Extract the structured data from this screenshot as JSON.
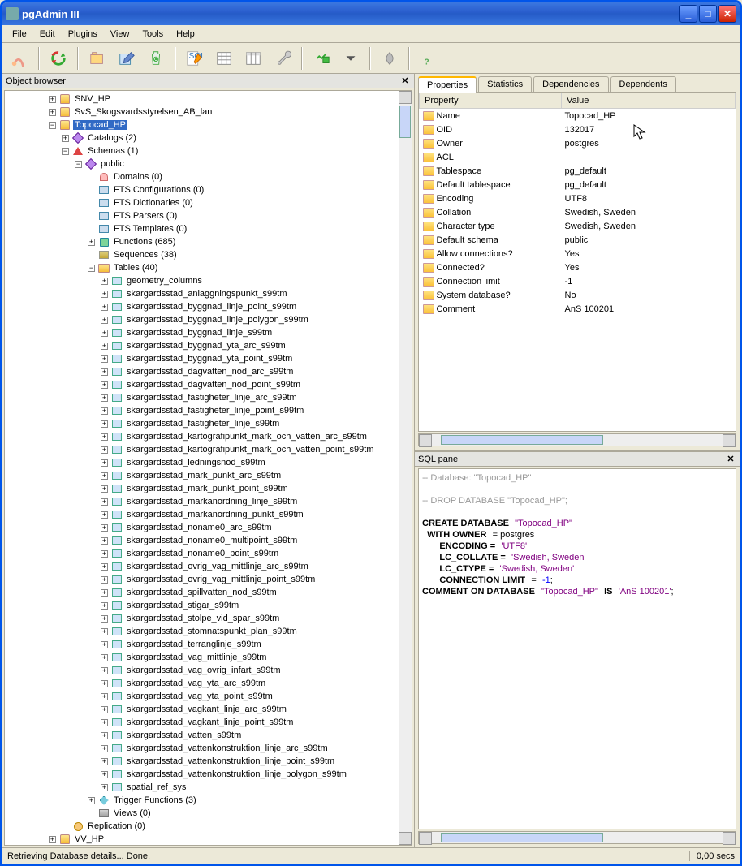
{
  "title": "pgAdmin III",
  "menus": [
    "File",
    "Edit",
    "Plugins",
    "View",
    "Tools",
    "Help"
  ],
  "object_browser_title": "Object browser",
  "sql_pane_title": "SQL pane",
  "status_left": "Retrieving Database details... Done.",
  "status_right": "0,00 secs",
  "tabs": [
    "Properties",
    "Statistics",
    "Dependencies",
    "Dependents"
  ],
  "prop_headers": [
    "Property",
    "Value"
  ],
  "properties": [
    {
      "name": "Name",
      "value": "Topocad_HP"
    },
    {
      "name": "OID",
      "value": "132017"
    },
    {
      "name": "Owner",
      "value": "postgres"
    },
    {
      "name": "ACL",
      "value": ""
    },
    {
      "name": "Tablespace",
      "value": "pg_default"
    },
    {
      "name": "Default tablespace",
      "value": "pg_default"
    },
    {
      "name": "Encoding",
      "value": "UTF8"
    },
    {
      "name": "Collation",
      "value": "Swedish, Sweden"
    },
    {
      "name": "Character type",
      "value": "Swedish, Sweden"
    },
    {
      "name": "Default schema",
      "value": "public"
    },
    {
      "name": "Allow connections?",
      "value": "Yes"
    },
    {
      "name": "Connected?",
      "value": "Yes"
    },
    {
      "name": "Connection limit",
      "value": "-1"
    },
    {
      "name": "System database?",
      "value": "No"
    },
    {
      "name": "Comment",
      "value": "AnS 100201"
    }
  ],
  "sql": {
    "c1": "-- Database: \"Topocad_HP\"",
    "c2": "-- DROP DATABASE \"Topocad_HP\";",
    "l1a": "CREATE DATABASE",
    "l1b": "\"Topocad_HP\"",
    "l2a": "  WITH OWNER",
    "l2b": "= postgres",
    "l3a": "       ENCODING =",
    "l3b": "'UTF8'",
    "l4a": "       LC_COLLATE =",
    "l4b": "'Swedish, Sweden'",
    "l5a": "       LC_CTYPE =",
    "l5b": "'Swedish, Sweden'",
    "l6a": "       CONNECTION LIMIT",
    "l6b": "=",
    "l6c": "-1",
    "l6d": ";",
    "l7a": "COMMENT ON DATABASE",
    "l7b": "\"Topocad_HP\"",
    "l7c": "IS",
    "l7d": "'AnS 100201'",
    "l7e": ";"
  },
  "tree": [
    {
      "indent": 3,
      "toggle": "+",
      "icon": "db",
      "label": "SNV_HP"
    },
    {
      "indent": 3,
      "toggle": "+",
      "icon": "db",
      "label": "SvS_Skogsvardsstyrelsen_AB_lan"
    },
    {
      "indent": 3,
      "toggle": "-",
      "icon": "db",
      "label": "Topocad_HP",
      "selected": true
    },
    {
      "indent": 4,
      "toggle": "+",
      "icon": "catalog",
      "label": "Catalogs (2)"
    },
    {
      "indent": 4,
      "toggle": "-",
      "icon": "schema",
      "label": "Schemas (1)"
    },
    {
      "indent": 5,
      "toggle": "-",
      "icon": "catalog",
      "label": "public"
    },
    {
      "indent": 6,
      "toggle": "",
      "icon": "domain",
      "label": "Domains (0)"
    },
    {
      "indent": 6,
      "toggle": "",
      "icon": "fts",
      "label": "FTS Configurations (0)"
    },
    {
      "indent": 6,
      "toggle": "",
      "icon": "fts",
      "label": "FTS Dictionaries (0)"
    },
    {
      "indent": 6,
      "toggle": "",
      "icon": "fts",
      "label": "FTS Parsers (0)"
    },
    {
      "indent": 6,
      "toggle": "",
      "icon": "fts",
      "label": "FTS Templates (0)"
    },
    {
      "indent": 6,
      "toggle": "+",
      "icon": "func",
      "label": "Functions (685)"
    },
    {
      "indent": 6,
      "toggle": "",
      "icon": "seq",
      "label": "Sequences (38)"
    },
    {
      "indent": 6,
      "toggle": "-",
      "icon": "folder",
      "label": "Tables (40)"
    },
    {
      "indent": 7,
      "toggle": "+",
      "icon": "table",
      "label": "geometry_columns"
    },
    {
      "indent": 7,
      "toggle": "+",
      "icon": "table",
      "label": "skargardsstad_anlaggningspunkt_s99tm"
    },
    {
      "indent": 7,
      "toggle": "+",
      "icon": "table",
      "label": "skargardsstad_byggnad_linje_point_s99tm"
    },
    {
      "indent": 7,
      "toggle": "+",
      "icon": "table",
      "label": "skargardsstad_byggnad_linje_polygon_s99tm"
    },
    {
      "indent": 7,
      "toggle": "+",
      "icon": "table",
      "label": "skargardsstad_byggnad_linje_s99tm"
    },
    {
      "indent": 7,
      "toggle": "+",
      "icon": "table",
      "label": "skargardsstad_byggnad_yta_arc_s99tm"
    },
    {
      "indent": 7,
      "toggle": "+",
      "icon": "table",
      "label": "skargardsstad_byggnad_yta_point_s99tm"
    },
    {
      "indent": 7,
      "toggle": "+",
      "icon": "table",
      "label": "skargardsstad_dagvatten_nod_arc_s99tm"
    },
    {
      "indent": 7,
      "toggle": "+",
      "icon": "table",
      "label": "skargardsstad_dagvatten_nod_point_s99tm"
    },
    {
      "indent": 7,
      "toggle": "+",
      "icon": "table",
      "label": "skargardsstad_fastigheter_linje_arc_s99tm"
    },
    {
      "indent": 7,
      "toggle": "+",
      "icon": "table",
      "label": "skargardsstad_fastigheter_linje_point_s99tm"
    },
    {
      "indent": 7,
      "toggle": "+",
      "icon": "table",
      "label": "skargardsstad_fastigheter_linje_s99tm"
    },
    {
      "indent": 7,
      "toggle": "+",
      "icon": "table",
      "label": "skargardsstad_kartografipunkt_mark_och_vatten_arc_s99tm"
    },
    {
      "indent": 7,
      "toggle": "+",
      "icon": "table",
      "label": "skargardsstad_kartografipunkt_mark_och_vatten_point_s99tm"
    },
    {
      "indent": 7,
      "toggle": "+",
      "icon": "table",
      "label": "skargardsstad_ledningsnod_s99tm"
    },
    {
      "indent": 7,
      "toggle": "+",
      "icon": "table",
      "label": "skargardsstad_mark_punkt_arc_s99tm"
    },
    {
      "indent": 7,
      "toggle": "+",
      "icon": "table",
      "label": "skargardsstad_mark_punkt_point_s99tm"
    },
    {
      "indent": 7,
      "toggle": "+",
      "icon": "table",
      "label": "skargardsstad_markanordning_linje_s99tm"
    },
    {
      "indent": 7,
      "toggle": "+",
      "icon": "table",
      "label": "skargardsstad_markanordning_punkt_s99tm"
    },
    {
      "indent": 7,
      "toggle": "+",
      "icon": "table",
      "label": "skargardsstad_noname0_arc_s99tm"
    },
    {
      "indent": 7,
      "toggle": "+",
      "icon": "table",
      "label": "skargardsstad_noname0_multipoint_s99tm"
    },
    {
      "indent": 7,
      "toggle": "+",
      "icon": "table",
      "label": "skargardsstad_noname0_point_s99tm"
    },
    {
      "indent": 7,
      "toggle": "+",
      "icon": "table",
      "label": "skargardsstad_ovrig_vag_mittlinje_arc_s99tm"
    },
    {
      "indent": 7,
      "toggle": "+",
      "icon": "table",
      "label": "skargardsstad_ovrig_vag_mittlinje_point_s99tm"
    },
    {
      "indent": 7,
      "toggle": "+",
      "icon": "table",
      "label": "skargardsstad_spillvatten_nod_s99tm"
    },
    {
      "indent": 7,
      "toggle": "+",
      "icon": "table",
      "label": "skargardsstad_stigar_s99tm"
    },
    {
      "indent": 7,
      "toggle": "+",
      "icon": "table",
      "label": "skargardsstad_stolpe_vid_spar_s99tm"
    },
    {
      "indent": 7,
      "toggle": "+",
      "icon": "table",
      "label": "skargardsstad_stomnatspunkt_plan_s99tm"
    },
    {
      "indent": 7,
      "toggle": "+",
      "icon": "table",
      "label": "skargardsstad_terranglinje_s99tm"
    },
    {
      "indent": 7,
      "toggle": "+",
      "icon": "table",
      "label": "skargardsstad_vag_mittlinje_s99tm"
    },
    {
      "indent": 7,
      "toggle": "+",
      "icon": "table",
      "label": "skargardsstad_vag_ovrig_infart_s99tm"
    },
    {
      "indent": 7,
      "toggle": "+",
      "icon": "table",
      "label": "skargardsstad_vag_yta_arc_s99tm"
    },
    {
      "indent": 7,
      "toggle": "+",
      "icon": "table",
      "label": "skargardsstad_vag_yta_point_s99tm"
    },
    {
      "indent": 7,
      "toggle": "+",
      "icon": "table",
      "label": "skargardsstad_vagkant_linje_arc_s99tm"
    },
    {
      "indent": 7,
      "toggle": "+",
      "icon": "table",
      "label": "skargardsstad_vagkant_linje_point_s99tm"
    },
    {
      "indent": 7,
      "toggle": "+",
      "icon": "table",
      "label": "skargardsstad_vatten_s99tm"
    },
    {
      "indent": 7,
      "toggle": "+",
      "icon": "table",
      "label": "skargardsstad_vattenkonstruktion_linje_arc_s99tm"
    },
    {
      "indent": 7,
      "toggle": "+",
      "icon": "table",
      "label": "skargardsstad_vattenkonstruktion_linje_point_s99tm"
    },
    {
      "indent": 7,
      "toggle": "+",
      "icon": "table",
      "label": "skargardsstad_vattenkonstruktion_linje_polygon_s99tm"
    },
    {
      "indent": 7,
      "toggle": "+",
      "icon": "table",
      "label": "spatial_ref_sys"
    },
    {
      "indent": 6,
      "toggle": "+",
      "icon": "trigger",
      "label": "Trigger Functions (3)"
    },
    {
      "indent": 6,
      "toggle": "",
      "icon": "views",
      "label": "Views (0)"
    },
    {
      "indent": 4,
      "toggle": "",
      "icon": "repl",
      "label": "Replication (0)"
    },
    {
      "indent": 3,
      "toggle": "+",
      "icon": "db",
      "label": "VV_HP"
    }
  ]
}
